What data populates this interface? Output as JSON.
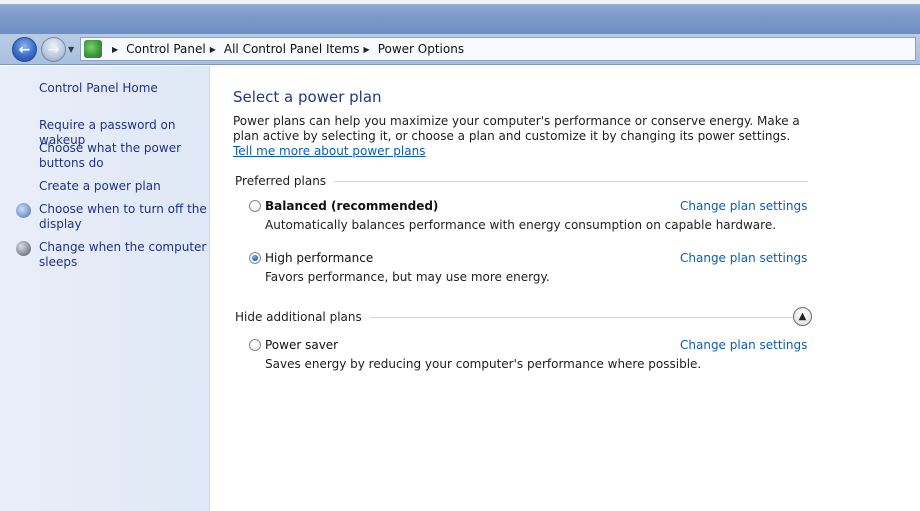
{
  "breadcrumb": [
    "Control Panel",
    "All Control Panel Items",
    "Power Options"
  ],
  "sidebar": {
    "home": "Control Panel Home",
    "items": [
      {
        "label": "Require a password on wakeup",
        "icon": ""
      },
      {
        "label": "Choose what the power buttons do",
        "icon": ""
      },
      {
        "label": "Create a power plan",
        "icon": ""
      },
      {
        "label": "Choose when to turn off the display",
        "icon": "display-clock-icon"
      },
      {
        "label": "Change when the computer sleeps",
        "icon": "moon-icon"
      }
    ]
  },
  "main": {
    "title": "Select a power plan",
    "intro_text": "Power plans can help you maximize your computer's performance or conserve energy. Make a plan active by selecting it, or choose a plan and customize it by changing its power settings. ",
    "intro_link": "Tell me more about power plans",
    "preferred_heading": "Preferred plans",
    "additional_heading": "Hide additional plans",
    "change_label": "Change plan settings",
    "plans": [
      {
        "name": "Balanced (recommended)",
        "desc": "Automatically balances performance with energy consumption on capable hardware.",
        "selected": false
      },
      {
        "name": "High performance",
        "desc": "Favors performance, but may use more energy.",
        "selected": true
      },
      {
        "name": "Power saver",
        "desc": "Saves energy by reducing your computer's performance where possible.",
        "selected": false
      }
    ]
  },
  "colors": {
    "link": "#1e3287",
    "title": "#1e3a86",
    "left_pane": "#e4ebf7"
  }
}
